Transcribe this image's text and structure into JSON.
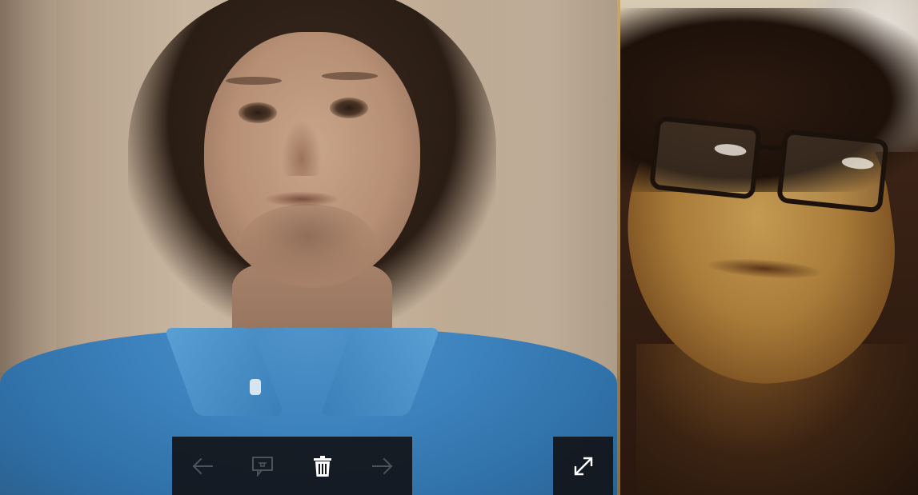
{
  "photos": {
    "main": {
      "description_icon": "person-photo"
    },
    "side": {
      "description_icon": "person-photo"
    }
  },
  "toolbar": {
    "buttons": [
      {
        "name": "previous-button",
        "icon": "arrow-left-icon",
        "enabled": false
      },
      {
        "name": "comment-button",
        "icon": "comment-icon",
        "enabled": false
      },
      {
        "name": "delete-button",
        "icon": "trash-icon",
        "enabled": true
      },
      {
        "name": "next-button",
        "icon": "arrow-right-icon",
        "enabled": false
      }
    ]
  },
  "expand": {
    "icon": "expand-icon"
  },
  "colors": {
    "toolbar_bg": "#121418",
    "icon_active": "#ffffff",
    "icon_disabled": "#8a8d92"
  }
}
